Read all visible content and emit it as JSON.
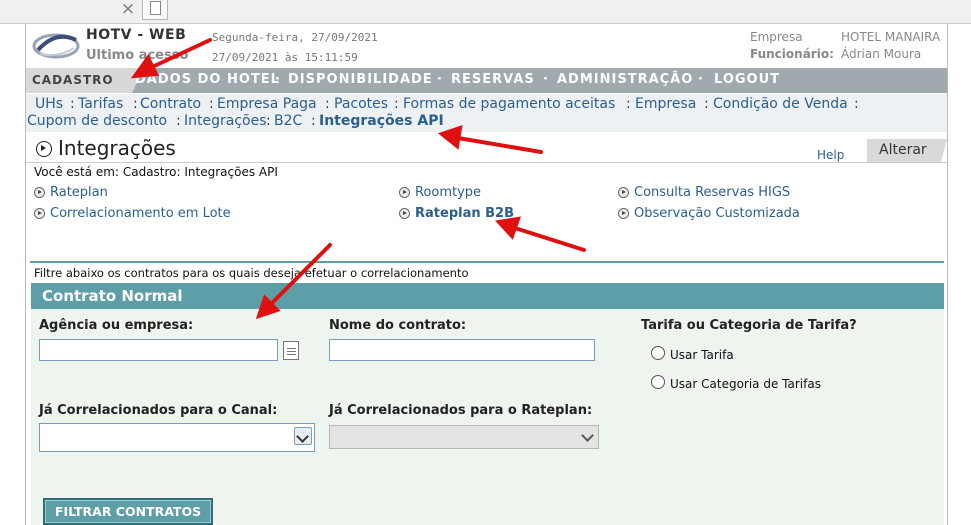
{
  "browser": {
    "close_tab_glyph": "×",
    "new_tab_icon": "document-icon"
  },
  "header": {
    "app_title": "HOTV - WEB",
    "last_access_label": "Ultimo acesso",
    "current_date": "Segunda-feira, 27/09/2021",
    "last_access_value": "27/09/2021  às  15:11:59",
    "company_label": "Empresa",
    "company_value": "HOTEL MANAIRA",
    "employee_label": "Funcionário:",
    "employee_value": "Ádrian Moura"
  },
  "main_nav": {
    "active": "CADASTRO",
    "items": [
      "DADOS DO HOTEL",
      "DISPONIBILIDADE",
      "RESERVAS",
      "ADMINISTRAÇÃO",
      "LOGOUT"
    ],
    "separator": "·"
  },
  "sub_nav": {
    "row1": [
      "UHs",
      "Tarifas",
      "Contrato",
      "Empresa Paga",
      "Pacotes",
      "Formas de pagamento aceitas",
      "Empresa",
      "Condição de Venda"
    ],
    "row2": [
      "Cupom de desconto",
      "Integrações",
      "B2C"
    ],
    "current": "Integrações API",
    "separator": ":"
  },
  "page": {
    "title": "Integrações",
    "help": "Help",
    "edit_tab": "Alterar",
    "breadcrumb": "Você está em: Cadastro: Integrações API"
  },
  "menu": {
    "col1": [
      "Rateplan",
      "Correlacionamento em Lote"
    ],
    "col2": [
      "Roomtype",
      "Rateplan B2B"
    ],
    "col3": [
      "Consulta Reservas HIGS",
      "Observação Customizada"
    ]
  },
  "filter": {
    "hint": "Filtre abaixo os contratos para os quais deseja efetuar o correlacionamento",
    "section_title": "Contrato Normal",
    "agency_label": "Agência ou empresa:",
    "agency_value": "",
    "contract_name_label": "Nome do contrato:",
    "contract_name_value": "",
    "rate_question": "Tarifa ou Categoria de Tarifa?",
    "radio_rate": "Usar Tarifa",
    "radio_category": "Usar Categoria de Tarifas",
    "channel_label": "Já Correlacionados para o Canal:",
    "channel_value": "",
    "rateplan_label": "Já Correlacionados para o Rateplan:",
    "rateplan_value": "",
    "submit": "FILTRAR CONTRATOS"
  },
  "colors": {
    "nav_bg": "#a0a9ae",
    "link": "#2a5f8f",
    "section": "#5e9ea6",
    "form_bg": "#eef4ee",
    "annotation": "#e01010"
  }
}
